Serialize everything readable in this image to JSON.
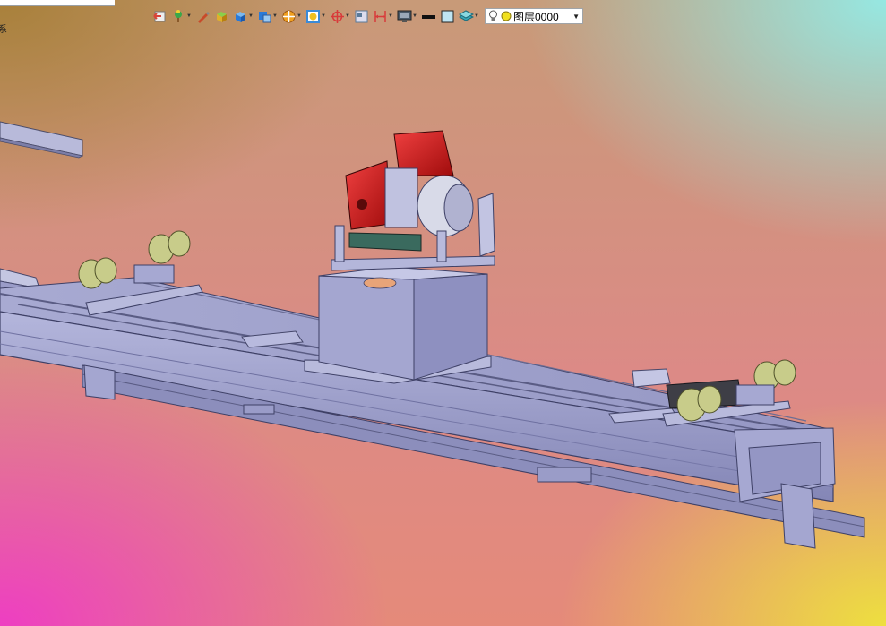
{
  "app": {
    "title_fragment": ""
  },
  "viewport": {
    "corner_text": "系",
    "background": [
      "#a8803a",
      "#96e8e2",
      "#ee3ac6",
      "#eee43c"
    ]
  },
  "toolbar": {
    "buttons": [
      {
        "name": "exit-sketch-icon",
        "color": "#d8453a"
      },
      {
        "name": "tree-plant-icon",
        "color": "#3aa84a"
      },
      {
        "name": "brush-icon",
        "color": "#c84a2a"
      },
      {
        "name": "material-cube-icon",
        "color": "#e0b02a"
      },
      {
        "name": "solid-cube-icon",
        "color": "#2a7ad8"
      },
      {
        "name": "multi-view-icon",
        "color": "#2a7ad8"
      },
      {
        "name": "render-style-icon",
        "color": "#f0a020"
      },
      {
        "name": "shading-icon",
        "color": "#3a8ad8"
      },
      {
        "name": "axis-icon",
        "color": "#d83a3a"
      },
      {
        "name": "grid-icon",
        "color": "#5a7a9a"
      },
      {
        "name": "dimension-icon",
        "color": "#d83a3a"
      },
      {
        "name": "monitor-icon",
        "color": "#4a5a6a"
      },
      {
        "name": "line-thickness-icon",
        "color": "#111111"
      },
      {
        "name": "fill-color-icon",
        "color": "#bfe4f2"
      },
      {
        "name": "layer-filter-icon",
        "color": "#3aa8b8"
      }
    ],
    "layer": {
      "value": "图层0000",
      "bulb_icon": "lightbulb-icon",
      "status_icon": "yellow-circle-icon"
    }
  },
  "model": {
    "frame_color": "#9a9cc6",
    "motor_color": "#d81c1c",
    "roller_color": "#c8cc8a"
  }
}
